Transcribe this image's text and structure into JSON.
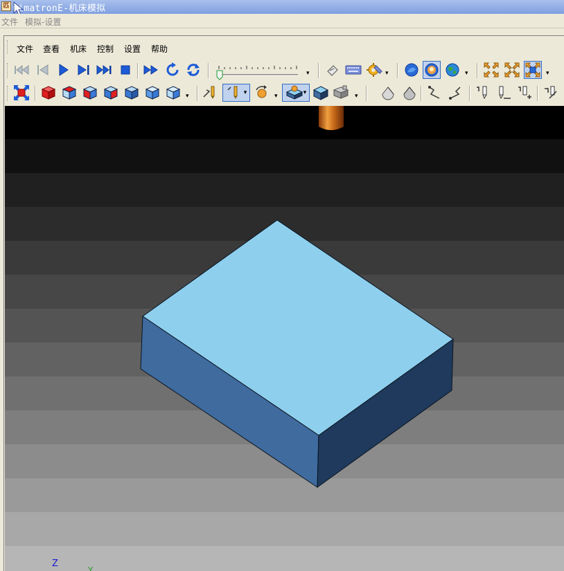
{
  "window": {
    "title": "CimatronE-机床模拟",
    "icon": "app-icon"
  },
  "outer_menu": {
    "file": "文件",
    "sim_settings": "模拟-设置"
  },
  "menu": {
    "file": "文件",
    "view": "查看",
    "machine": "机床",
    "control": "控制",
    "settings": "设置",
    "help": "帮助"
  },
  "viewport": {
    "axis_z": "Z",
    "axis_y": "Y",
    "background_bands": [
      "#000000",
      "#111111",
      "#202020",
      "#2c2c2c",
      "#3a3a3a",
      "#474747",
      "#545454",
      "#626262",
      "#707070",
      "#7e7e7e",
      "#8c8c8c",
      "#9a9a9a",
      "#a8a8a8",
      "#b6b6b6"
    ],
    "block_colors": {
      "top": "#8fcfee",
      "left": "#3f6b9e",
      "right": "#1f3a5c"
    },
    "tool_color": "#c86a1a"
  },
  "colors": {
    "accent": "#316ac5",
    "title_gradient_top": "#a9c0ec",
    "title_gradient_bottom": "#7f9fe0"
  }
}
